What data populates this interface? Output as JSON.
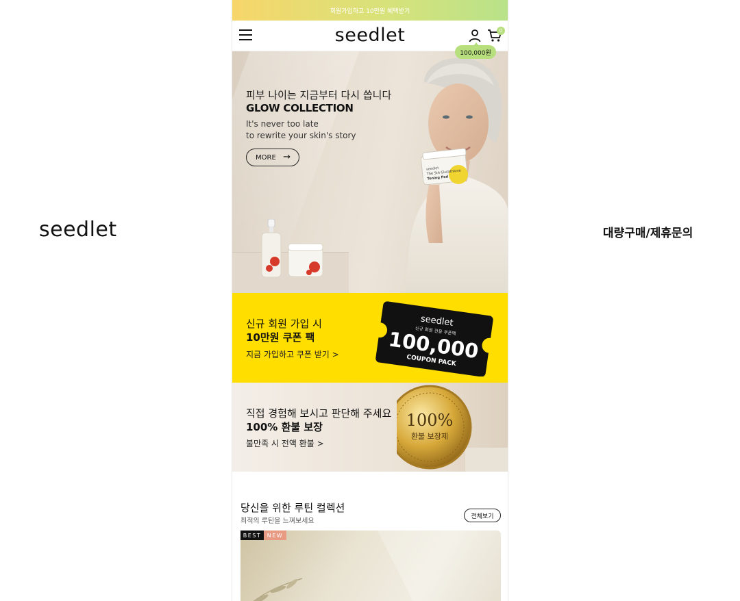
{
  "side": {
    "logo": "seedlet",
    "inquiry": "대량구매/제휴문의"
  },
  "topbar": {
    "text": "회원가입하고 10만원 혜택받기"
  },
  "header": {
    "brand": "seedlet",
    "cart_count": "0",
    "cart_bubble": "100,000원"
  },
  "hero": {
    "subtitle": "피부 나이는 지금부터 다시 씁니다",
    "title": "GLOW COLLECTION",
    "desc_line1": "It's never too late",
    "desc_line2": "to rewrite your skin's story",
    "more_label": "MORE",
    "more_arrow": "→",
    "jar_label_1": "seedlet",
    "jar_label_2": "The 5th Glutathione",
    "jar_label_3": "Toning Pad"
  },
  "coupon": {
    "line1": "신규 회원 가입 시",
    "line2": "10만원 쿠폰 팩",
    "link": "지금 가입하고 쿠폰 받기 >",
    "ticket_brand": "seedlet",
    "ticket_sub": "신규 회원 전용 쿠폰팩",
    "ticket_amount": "100,000",
    "ticket_caption": "COUPON PACK"
  },
  "refund": {
    "line1": "직접 경험해 보시고 판단해 주세요",
    "line2": "100% 환불 보장",
    "link": "불만족 시 전액 환불 >",
    "medal_big": "100%",
    "medal_small": "환불 보장제"
  },
  "routine": {
    "title": "당신을 위한 루틴 컬렉션",
    "subtitle": "최적의 루틴을 느껴보세요",
    "view_all": "전체보기",
    "badge_best": "BEST",
    "badge_new": "NEW"
  },
  "colors": {
    "accent_green": "#b7df7d",
    "coupon_yellow": "#ffde00",
    "badge_new": "#e99a82"
  }
}
